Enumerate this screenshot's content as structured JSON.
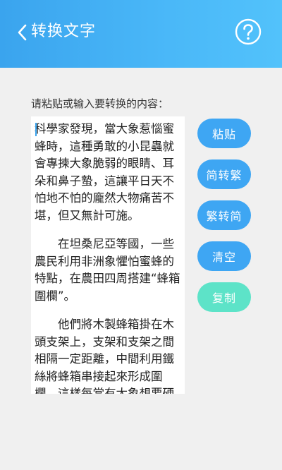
{
  "header": {
    "title": "转换文字",
    "back_icon": "chevron-left-icon",
    "help_icon": "question-circle-icon"
  },
  "prompt_label": "请粘贴或输入要转换的内容：",
  "textbox": {
    "paragraphs": [
      "科學家發現，當大象惹惱蜜蜂時，這種勇敢的小昆蟲就會專揀大象脆弱的眼睛、耳朵和鼻子蟄，這讓平日天不怕地不怕的龐然大物痛苦不堪，但又無計可施。",
      "在坦桑尼亞等國，一些農民利用非洲象懼怕蜜蜂的特點，在農田四周搭建“蜂箱圍欄”。",
      "他們將木製蜂箱掛在木頭支架上，支架和支架之間相隔一定距離，中間利用鐵絲將蜂箱串接起來形成圍欄，這樣每當有大象想要硬"
    ]
  },
  "buttons": {
    "paste": "粘贴",
    "to_simplified_from": "简转繁",
    "to_simplified": "繁转简",
    "clear": "清空",
    "copy": "复制"
  },
  "colors": {
    "header": "#3aa4ee",
    "button": "#3ea6f3",
    "copy_button": "#5de3c8"
  }
}
